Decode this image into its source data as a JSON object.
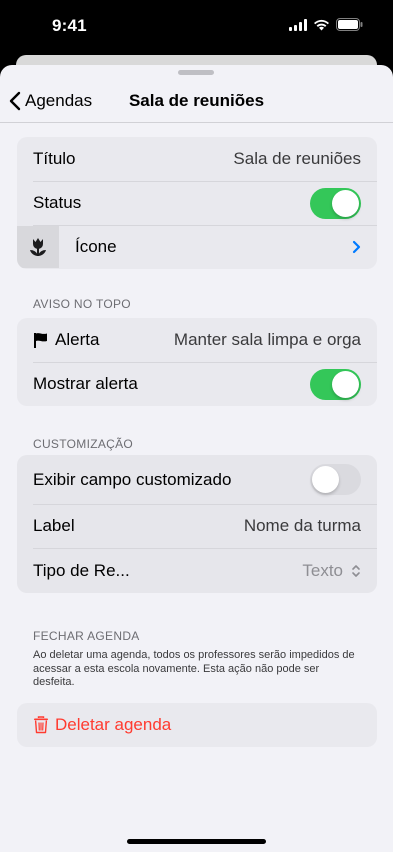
{
  "status_bar": {
    "time": "9:41",
    "icons": [
      "signal-icon",
      "wifi-icon",
      "battery-icon"
    ]
  },
  "nav": {
    "back_label": "Agendas",
    "title": "Sala de reuniões"
  },
  "general": {
    "title_label": "Título",
    "title_value": "Sala de reuniões",
    "status_label": "Status",
    "status_on": true,
    "icon_label": "Ícone"
  },
  "aviso": {
    "header": "AVISO NO TOPO",
    "alert_label": "Alerta",
    "alert_value": "Manter sala limpa e orga",
    "show_alert_label": "Mostrar alerta",
    "show_alert_on": true
  },
  "custom": {
    "header": "CUSTOMIZAÇÃO",
    "show_field_label": "Exibir campo customizado",
    "show_field_on": false,
    "label_label": "Label",
    "label_value": "Nome da turma",
    "type_label": "Tipo de Re...",
    "type_value": "Texto"
  },
  "close": {
    "header": "FECHAR AGENDA",
    "description": "Ao deletar uma agenda, todos os professores serão impedidos de acessar a esta escola novamente. Esta ação não pode ser desfeita.",
    "delete_label": "Deletar agenda"
  },
  "colors": {
    "accent_green": "#34c759",
    "destructive": "#ff3b30",
    "link_blue": "#007aff"
  }
}
